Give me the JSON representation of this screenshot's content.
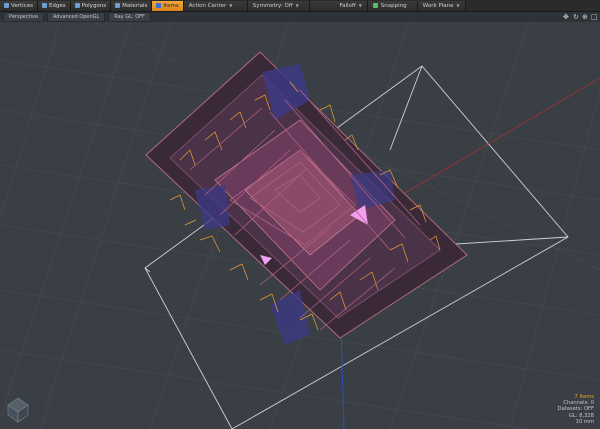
{
  "toolbar": {
    "tabs": [
      {
        "label": "Vertices",
        "icon": "vertices-icon"
      },
      {
        "label": "Edges",
        "icon": "edges-icon"
      },
      {
        "label": "Polygons",
        "icon": "polygons-icon"
      },
      {
        "label": "Materials",
        "icon": "materials-icon"
      },
      {
        "label": "Items",
        "icon": "items-icon",
        "active": true
      }
    ],
    "action_center": "Action Center",
    "symmetry": "Symmetry: Off",
    "falloff": "Falloff",
    "snapping": "Snapping",
    "work_plane": "Work Plane"
  },
  "viewbar": {
    "projection": "Perspective",
    "shading": "Advanced OpenGL",
    "ray_gl": "Ray GL: OFF"
  },
  "stats": {
    "selection": "7 Items",
    "channels": "Channels: 0",
    "datasets": "Datasets: OFF",
    "gl": "GL: 8,328",
    "unit": "10 mm"
  },
  "colors": {
    "viewport_bg": "#3a3f45",
    "grid": "#4a5058",
    "maze_walls": "#8a5570",
    "maze_highlight": "#e8a030",
    "active_tab": "#f0a030"
  }
}
